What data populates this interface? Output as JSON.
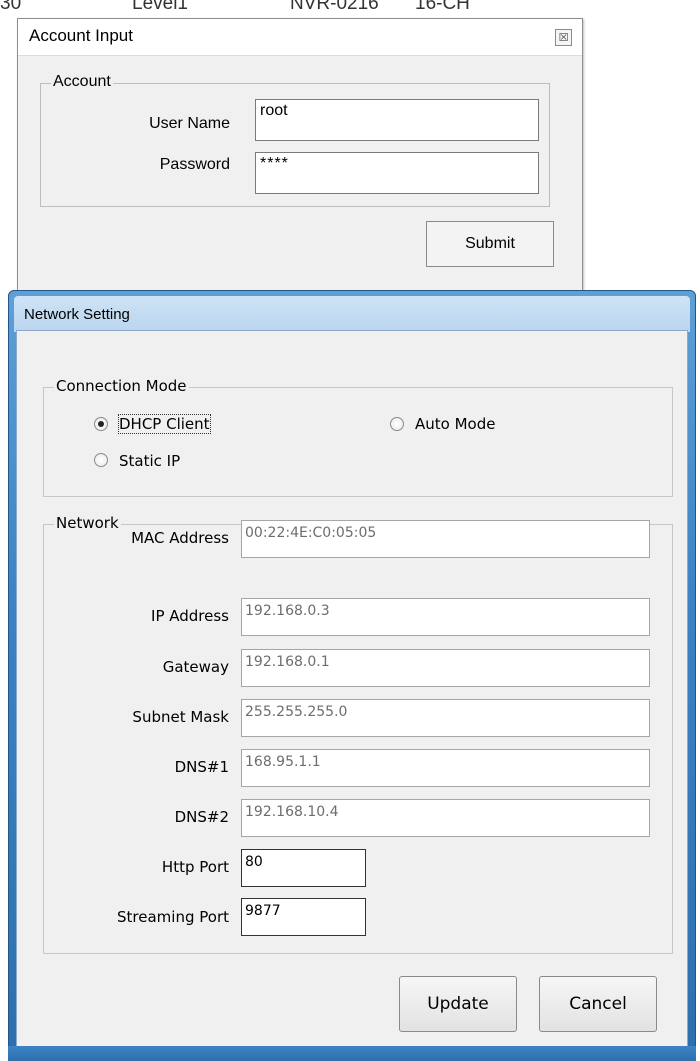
{
  "background_window": {
    "fragments": [
      "30",
      "Level1",
      "NVR-0216",
      "16-CH"
    ]
  },
  "account_dialog": {
    "title": "Account Input",
    "close_glyph": "☒",
    "group_label": "Account",
    "username_label": "User Name",
    "username_value": "root",
    "password_label": "Password",
    "password_value": "****",
    "submit_label": "Submit"
  },
  "network_dialog": {
    "title": "Network Setting",
    "connection_mode": {
      "label": "Connection Mode",
      "options": [
        {
          "label": "DHCP Client",
          "selected": true
        },
        {
          "label": "Auto Mode",
          "selected": false
        },
        {
          "label": "Static IP",
          "selected": false
        }
      ]
    },
    "network": {
      "label": "Network",
      "fields": [
        {
          "label": "MAC Address",
          "value": "00:22:4E:C0:05:05"
        },
        {
          "label": "IP Address",
          "value": "192.168.0.3"
        },
        {
          "label": "Gateway",
          "value": "192.168.0.1"
        },
        {
          "label": "Subnet Mask",
          "value": "255.255.255.0"
        },
        {
          "label": "DNS#1",
          "value": "168.95.1.1"
        },
        {
          "label": "DNS#2",
          "value": "192.168.10.4"
        },
        {
          "label": "Http Port",
          "value": "80"
        },
        {
          "label": "Streaming Port",
          "value": "9877"
        }
      ]
    },
    "update_label": "Update",
    "cancel_label": "Cancel"
  }
}
